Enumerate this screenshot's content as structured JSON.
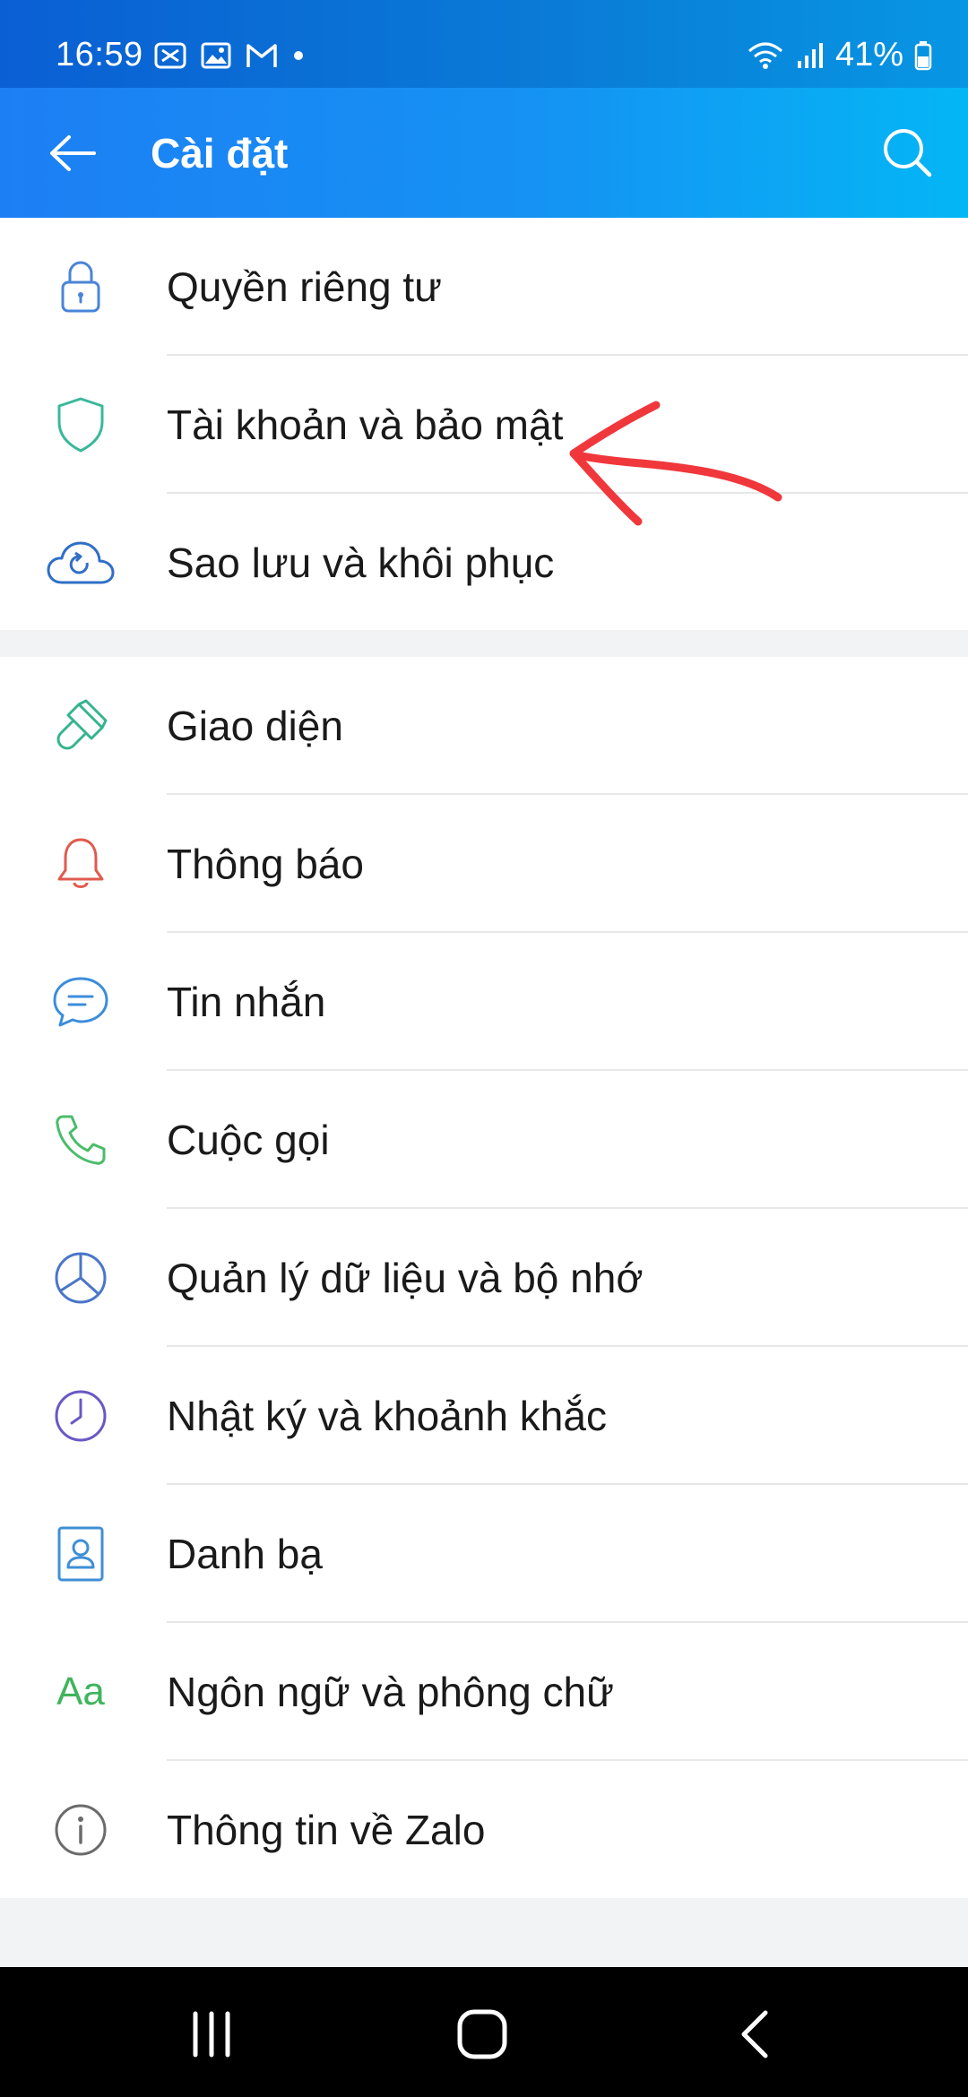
{
  "status_bar": {
    "time": "16:59",
    "battery": "41%",
    "icons": [
      "capcut-icon",
      "gallery-icon",
      "gmail-icon",
      "dot-icon",
      "wifi-icon",
      "signal-icon",
      "battery-icon"
    ]
  },
  "header": {
    "title": "Cài đặt",
    "back_icon": "arrow-left-icon",
    "search_icon": "search-icon"
  },
  "groups": [
    {
      "items": [
        {
          "label": "Quyền riêng tư",
          "icon": "lock-icon"
        },
        {
          "label": "Tài khoản và bảo mật",
          "icon": "shield-icon"
        },
        {
          "label": "Sao lưu và khôi phục",
          "icon": "cloud-sync-icon"
        }
      ]
    },
    {
      "items": [
        {
          "label": "Giao diện",
          "icon": "paintbrush-icon"
        },
        {
          "label": "Thông báo",
          "icon": "bell-icon"
        },
        {
          "label": "Tin nhắn",
          "icon": "chat-bubble-icon"
        },
        {
          "label": "Cuộc gọi",
          "icon": "phone-icon"
        },
        {
          "label": "Quản lý dữ liệu và bộ nhớ",
          "icon": "pie-chart-icon"
        },
        {
          "label": "Nhật ký và khoảnh khắc",
          "icon": "clock-icon"
        },
        {
          "label": "Danh bạ",
          "icon": "contact-icon"
        },
        {
          "label": "Ngôn ngữ và phông chữ",
          "icon": "font-icon",
          "icon_text": "Aa"
        },
        {
          "label": "Thông tin về Zalo",
          "icon": "info-icon"
        }
      ]
    }
  ],
  "colors": {
    "header_start": "#1d7ff4",
    "header_end": "#04b6f5",
    "annotation": "#f0383c"
  }
}
